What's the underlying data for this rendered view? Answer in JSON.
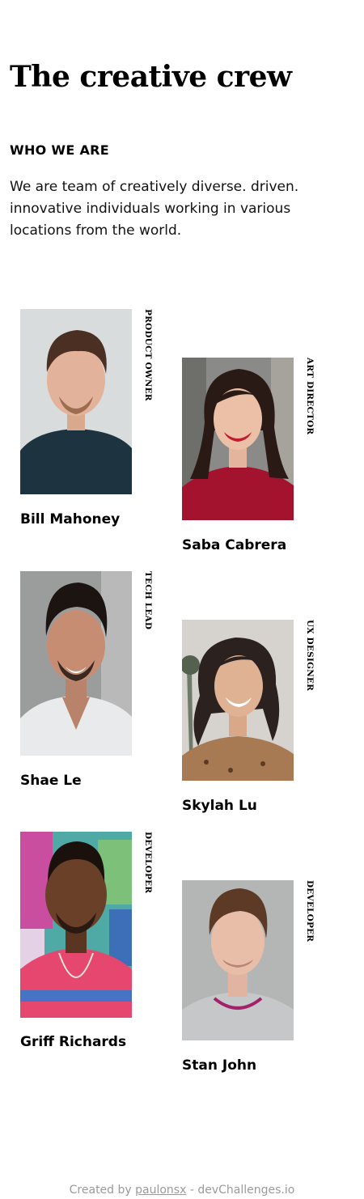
{
  "header": {
    "title": "The creative crew",
    "section_label": "WHO WE ARE",
    "intro": "We are team of creatively diverse. driven. innovative individuals working in various locations from the world."
  },
  "members": [
    {
      "name": "Bill Mahoney",
      "role": "PRODUCT OWNER",
      "photo_icon": "man-portrait-icon"
    },
    {
      "name": "Saba Cabrera",
      "role": "ART DIRECTOR",
      "photo_icon": "woman-portrait-icon"
    },
    {
      "name": "Shae Le",
      "role": "TECH LEAD",
      "photo_icon": "man-portrait-icon"
    },
    {
      "name": "Skylah Lu",
      "role": "UX DESIGNER",
      "photo_icon": "woman-portrait-icon"
    },
    {
      "name": "Griff Richards",
      "role": "DEVELOPER",
      "photo_icon": "man-portrait-icon"
    },
    {
      "name": "Stan John",
      "role": "DEVELOPER",
      "photo_icon": "man-portrait-icon"
    }
  ],
  "footer": {
    "prefix": "Created by",
    "author": "paulonsx",
    "separator": " - ",
    "site": "devChallenges.io"
  },
  "colors": {
    "text": "#000000",
    "footer_text": "#9a9a9a",
    "background": "#ffffff"
  }
}
